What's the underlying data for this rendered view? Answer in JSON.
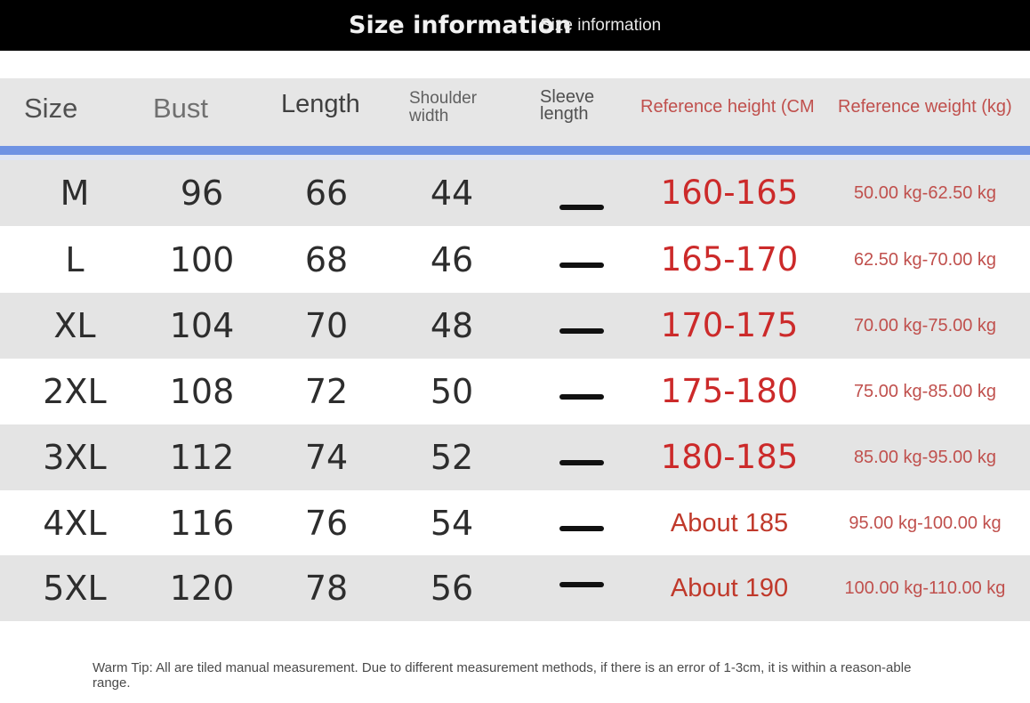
{
  "banner": {
    "title": "Size information",
    "title_overlay": "Size information"
  },
  "headers": {
    "size": "Size",
    "bust": "Bust",
    "length": "Length",
    "shoulder": "Shoulder width",
    "sleeve": "Sleeve length",
    "ref_height": "Reference height (CM",
    "ref_weight": "Reference weight (kg)"
  },
  "rows": [
    {
      "size": "M",
      "bust": "96",
      "length": "66",
      "shoulder": "44",
      "sleeve": "—",
      "height": "160-165",
      "weight": "50.00 kg-62.50 kg"
    },
    {
      "size": "L",
      "bust": "100",
      "length": "68",
      "shoulder": "46",
      "sleeve": "—",
      "height": "165-170",
      "weight": "62.50 kg-70.00 kg"
    },
    {
      "size": "XL",
      "bust": "104",
      "length": "70",
      "shoulder": "48",
      "sleeve": "—",
      "height": "170-175",
      "weight": "70.00 kg-75.00 kg"
    },
    {
      "size": "2XL",
      "bust": "108",
      "length": "72",
      "shoulder": "50",
      "sleeve": "—",
      "height": "175-180",
      "weight": "75.00 kg-85.00 kg"
    },
    {
      "size": "3XL",
      "bust": "112",
      "length": "74",
      "shoulder": "52",
      "sleeve": "—",
      "height": "180-185",
      "weight": "85.00 kg-95.00 kg"
    },
    {
      "size": "4XL",
      "bust": "116",
      "length": "76",
      "shoulder": "54",
      "sleeve": "—",
      "height": "About 185",
      "weight": "95.00 kg-100.00 kg"
    },
    {
      "size": "5XL",
      "bust": "120",
      "length": "78",
      "shoulder": "56",
      "sleeve": "—",
      "height": "About 190",
      "weight": "100.00 kg-110.00 kg"
    }
  ],
  "tip": "Warm Tip: All are tiled manual measurement. Due to different measurement methods, if there is an error of 1-3cm, it is within a reason-able range.",
  "colors": {
    "banner_bg": "#000000",
    "header_stripe": "#6f93e3",
    "accent_red": "#cc2a2a"
  }
}
